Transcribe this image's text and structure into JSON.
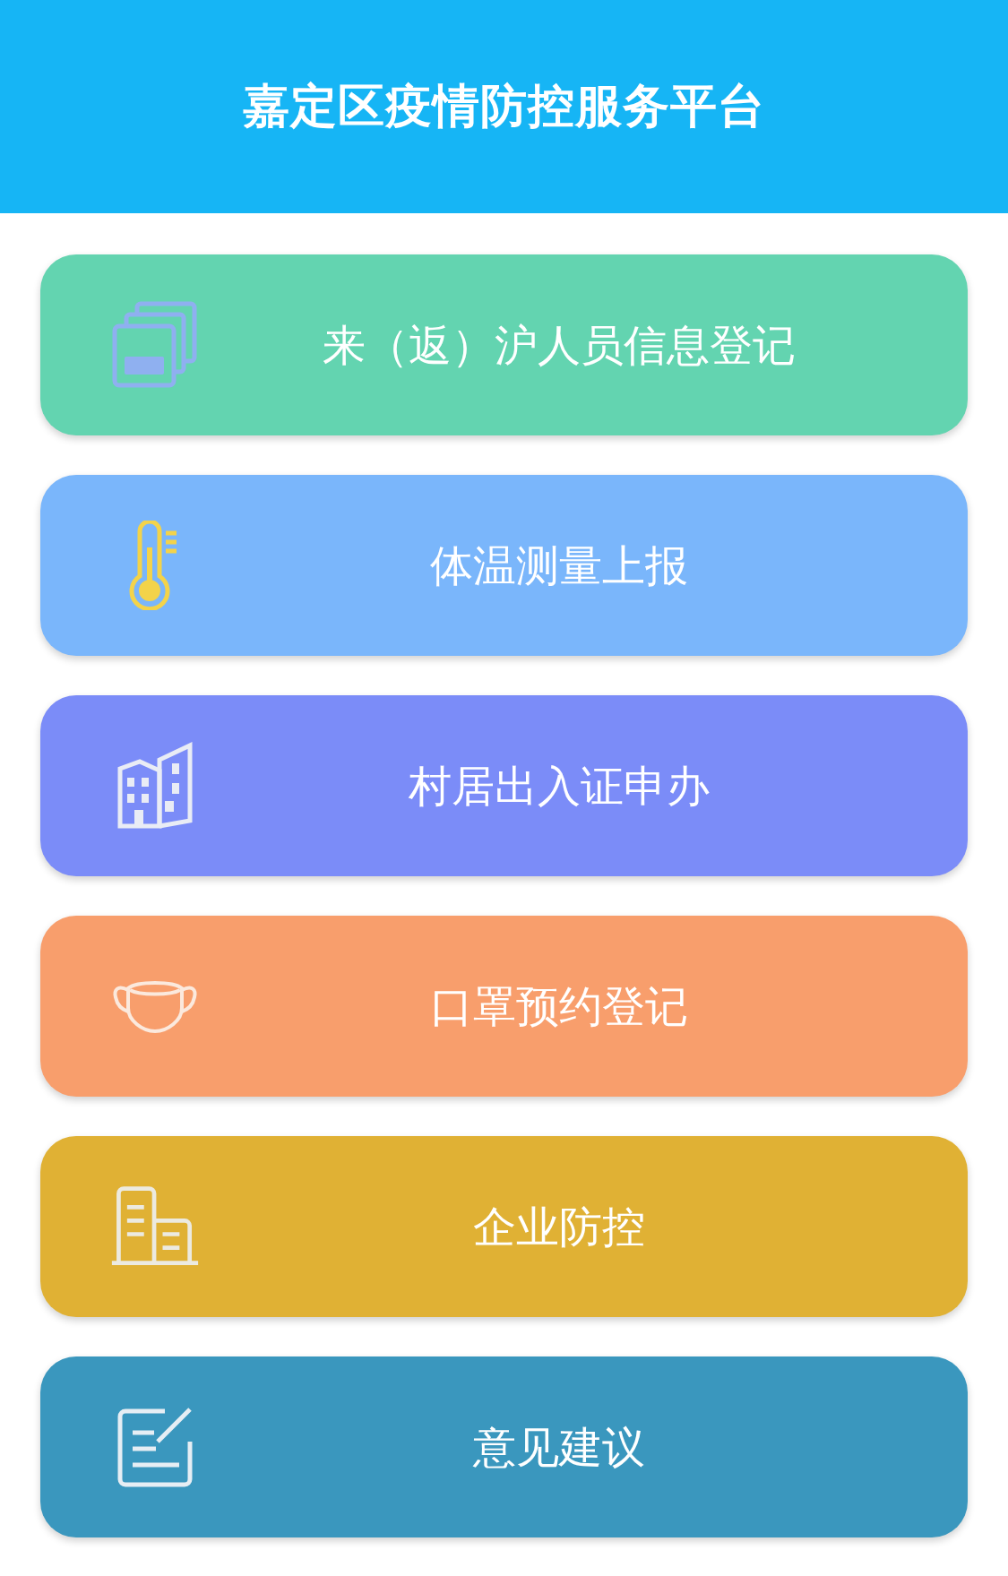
{
  "header": {
    "title": "嘉定区疫情防控服务平台"
  },
  "items": [
    {
      "label": "来（返）沪人员信息登记",
      "color": "#63d4b0",
      "kind": "cards"
    },
    {
      "label": "体温测量上报",
      "color": "#7ab6fb",
      "kind": "thermometer"
    },
    {
      "label": "村居出入证申办",
      "color": "#7b8cf8",
      "kind": "buildings"
    },
    {
      "label": "口罩预约登记",
      "color": "#f89e6c",
      "kind": "mask"
    },
    {
      "label": "企业防控",
      "color": "#e0b134",
      "kind": "office"
    },
    {
      "label": "意见建议",
      "color": "#3a97be",
      "kind": "note"
    }
  ]
}
